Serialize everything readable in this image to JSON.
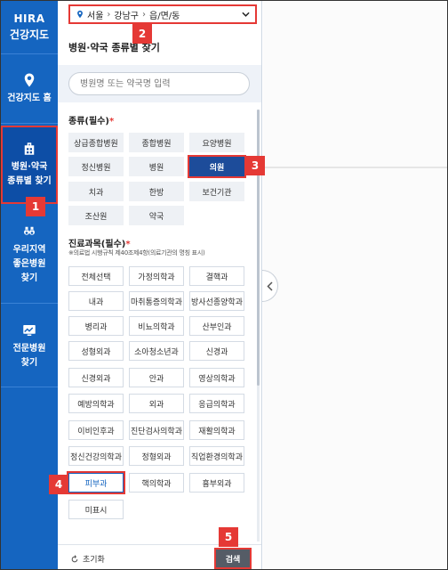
{
  "nav": {
    "logo_line1": "HIRA",
    "logo_line2": "건강지도",
    "items": [
      {
        "label_1": "건강지도 홈",
        "label_2": "",
        "label_3": ""
      },
      {
        "label_1": "병원·약국",
        "label_2": "종류별 찾기",
        "label_3": ""
      },
      {
        "label_1": "우리지역",
        "label_2": "좋은병원",
        "label_3": "찾기"
      },
      {
        "label_1": "전문병원",
        "label_2": "찾기",
        "label_3": ""
      }
    ]
  },
  "location": {
    "city": "서울",
    "district": "강남구",
    "dong": "읍/면/동"
  },
  "panel_title": "병원·약국 종류별 찾기",
  "search": {
    "placeholder": "병원명 또는 약국명 입력"
  },
  "type_section": {
    "label": "종류(필수)",
    "req": "*"
  },
  "types": [
    "상급종합병원",
    "종합병원",
    "요양병원",
    "정신병원",
    "병원",
    "의원",
    "치과",
    "한방",
    "보건기관",
    "조산원",
    "약국"
  ],
  "subject_section": {
    "label": "진료과목(필수)",
    "req": "*",
    "note": "※의료법 시행규칙 제40조제4항(의료기관의 명칭 표시)"
  },
  "subjects": [
    "전체선택",
    "가정의학과",
    "결핵과",
    "내과",
    "마취통증의학과",
    "방사선종양학과",
    "병리과",
    "비뇨의학과",
    "산부인과",
    "성형외과",
    "소아청소년과",
    "신경과",
    "신경외과",
    "안과",
    "영상의학과",
    "예방의학과",
    "외과",
    "응급의학과",
    "이비인후과",
    "진단검사의학과",
    "재활의학과",
    "정신건강의학과",
    "정형외과",
    "직업환경의학과",
    "피부과",
    "핵의학과",
    "흉부외과",
    "미표시"
  ],
  "footer": {
    "reset": "초기화",
    "search": "검색"
  },
  "badges": [
    "1",
    "2",
    "3",
    "4",
    "5"
  ],
  "colors": {
    "nav": "#1565c0",
    "selected": "#1d4c9a",
    "highlight": "#e53935"
  }
}
